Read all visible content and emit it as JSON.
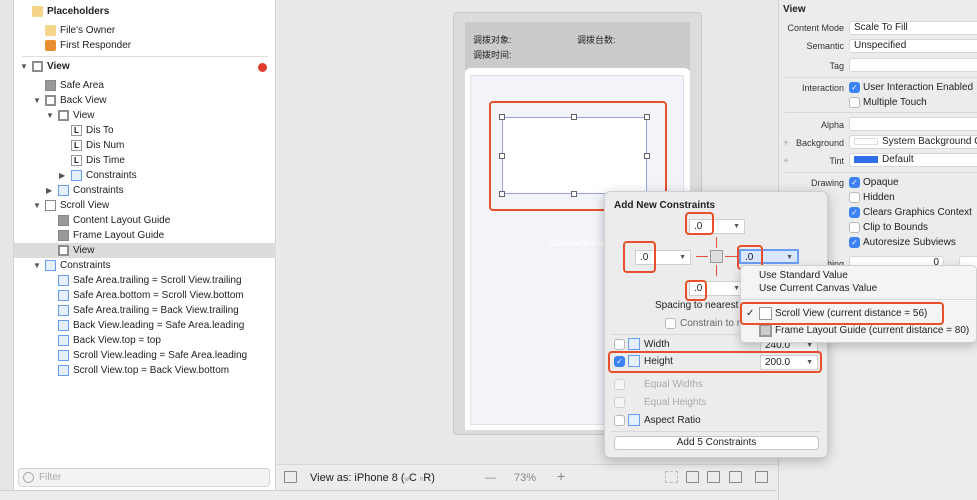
{
  "outline": {
    "rows": [
      {
        "label": "Placeholders",
        "icon": "cube-icon",
        "type": "cube",
        "level": 0,
        "bold": true,
        "arrow": ""
      },
      {
        "label": "File's Owner",
        "icon": "cube-icon",
        "type": "cube",
        "level": 1,
        "arrow": ""
      },
      {
        "label": "First Responder",
        "icon": "first-responder-icon",
        "type": "cube or",
        "level": 1,
        "arrow": ""
      },
      {
        "label": "View",
        "icon": "view-icon",
        "type": "view",
        "level": 0,
        "bold": true,
        "arrow": "▼"
      },
      {
        "label": "Safe Area",
        "icon": "safe-area-icon",
        "type": "guide",
        "level": 1,
        "arrow": ""
      },
      {
        "label": "Back View",
        "icon": "view-icon",
        "type": "view",
        "level": 1,
        "arrow": "▼"
      },
      {
        "label": "View",
        "icon": "view-icon",
        "type": "view",
        "level": 2,
        "arrow": "▼"
      },
      {
        "label": "Dis To",
        "icon": "label-icon",
        "type": "label",
        "level": 3,
        "arrow": "",
        "glyph": "L"
      },
      {
        "label": "Dis Num",
        "icon": "label-icon",
        "type": "label",
        "level": 3,
        "arrow": "",
        "glyph": "L"
      },
      {
        "label": "Dis Time",
        "icon": "label-icon",
        "type": "label",
        "level": 3,
        "arrow": "",
        "glyph": "L"
      },
      {
        "label": "Constraints",
        "icon": "constraints-icon",
        "type": "cons",
        "level": 3,
        "arrow": "▶"
      },
      {
        "label": "Constraints",
        "icon": "constraints-icon",
        "type": "cons",
        "level": 2,
        "arrow": "▶"
      },
      {
        "label": "Scroll View",
        "icon": "scroll-view-icon",
        "type": "",
        "level": 1,
        "arrow": "▼"
      },
      {
        "label": "Content Layout Guide",
        "icon": "layout-guide-icon",
        "type": "guide",
        "level": 2,
        "arrow": ""
      },
      {
        "label": "Frame Layout Guide",
        "icon": "layout-guide-icon",
        "type": "guide",
        "level": 2,
        "arrow": ""
      },
      {
        "label": "View",
        "icon": "view-icon",
        "type": "view",
        "level": 2,
        "arrow": "",
        "selected": true
      },
      {
        "label": "Constraints",
        "icon": "constraints-icon",
        "type": "cons",
        "level": 1,
        "arrow": "▼"
      },
      {
        "label": "Safe Area.trailing = Scroll View.trailing",
        "icon": "constraint-icon",
        "type": "cons",
        "level": 2,
        "arrow": ""
      },
      {
        "label": "Safe Area.bottom = Scroll View.bottom",
        "icon": "constraint-icon",
        "type": "cons",
        "level": 2,
        "arrow": ""
      },
      {
        "label": "Safe Area.trailing = Back View.trailing",
        "icon": "constraint-icon",
        "type": "cons",
        "level": 2,
        "arrow": ""
      },
      {
        "label": "Back View.leading = Safe Area.leading",
        "icon": "constraint-icon",
        "type": "cons",
        "level": 2,
        "arrow": ""
      },
      {
        "label": "Back View.top = top",
        "icon": "constraint-icon",
        "type": "cons",
        "level": 2,
        "arrow": ""
      },
      {
        "label": "Scroll View.leading = Safe Area.leading",
        "icon": "constraint-icon",
        "type": "cons",
        "level": 2,
        "arrow": ""
      },
      {
        "label": "Scroll View.top = Back View.bottom",
        "icon": "constraint-icon",
        "type": "cons",
        "level": 2,
        "arrow": ""
      }
    ],
    "filter_placeholder": "Filter"
  },
  "device": {
    "label_target": "调拨对象:",
    "label_count": "调拨台数:",
    "label_time": "调拨时间:",
    "scroll_watermark": "UIScrollView"
  },
  "canvas_bar": {
    "view_as": "View as: iPhone 8 (",
    "w_small": "w",
    "w_class": "C",
    "h_small": "h",
    "h_class": "R)",
    "zoom_out": "—",
    "zoom": "73%",
    "zoom_in": "+"
  },
  "popover": {
    "title": "Add New Constraints",
    "top": ".0",
    "left": ".0",
    "right": ".0",
    "bottom": ".0",
    "spacing_label": "Spacing to nearest neighbor",
    "constrain_margins": "Constrain to margins",
    "width_label": "Width",
    "width_value": "240.0",
    "width_checked": false,
    "height_label": "Height",
    "height_value": "200.0",
    "height_checked": true,
    "equal_widths": "Equal Widths",
    "equal_heights": "Equal Heights",
    "aspect_ratio": "Aspect Ratio",
    "add_button": "Add 5 Constraints"
  },
  "dropdown": {
    "items": [
      "Use Standard Value",
      "Use Current Canvas Value"
    ],
    "options": [
      {
        "label": "Scroll View (current distance = 56)",
        "checked": true
      },
      {
        "label": "Frame Layout Guide (current distance = 80)",
        "checked": false
      }
    ],
    "check": "✓"
  },
  "inspector": {
    "section": "View",
    "content_mode_label": "Content Mode",
    "content_mode": "Scale To Fill",
    "semantic_label": "Semantic",
    "semantic": "Unspecified",
    "tag_label": "Tag",
    "tag": "",
    "interaction_label": "Interaction",
    "user_interaction": "User Interaction Enabled",
    "multiple_touch": "Multiple Touch",
    "alpha_label": "Alpha",
    "alpha": "",
    "background_label": "Background",
    "background": "System Background Color",
    "tint_label": "Tint",
    "tint": "Default",
    "tint_color": "#2f6fe8",
    "drawing_label": "Drawing",
    "opaque": "Opaque",
    "hidden": "Hidden",
    "clears": "Clears Graphics Context",
    "clip": "Clip to Bounds",
    "autoresize": "Autoresize Subviews",
    "stretching_label": "Stretching",
    "stretching_x": "0",
    "plus": "+"
  },
  "colors": {
    "accent": "#3b82f6",
    "highlight": "#e8502d",
    "error": "#e23b30"
  }
}
